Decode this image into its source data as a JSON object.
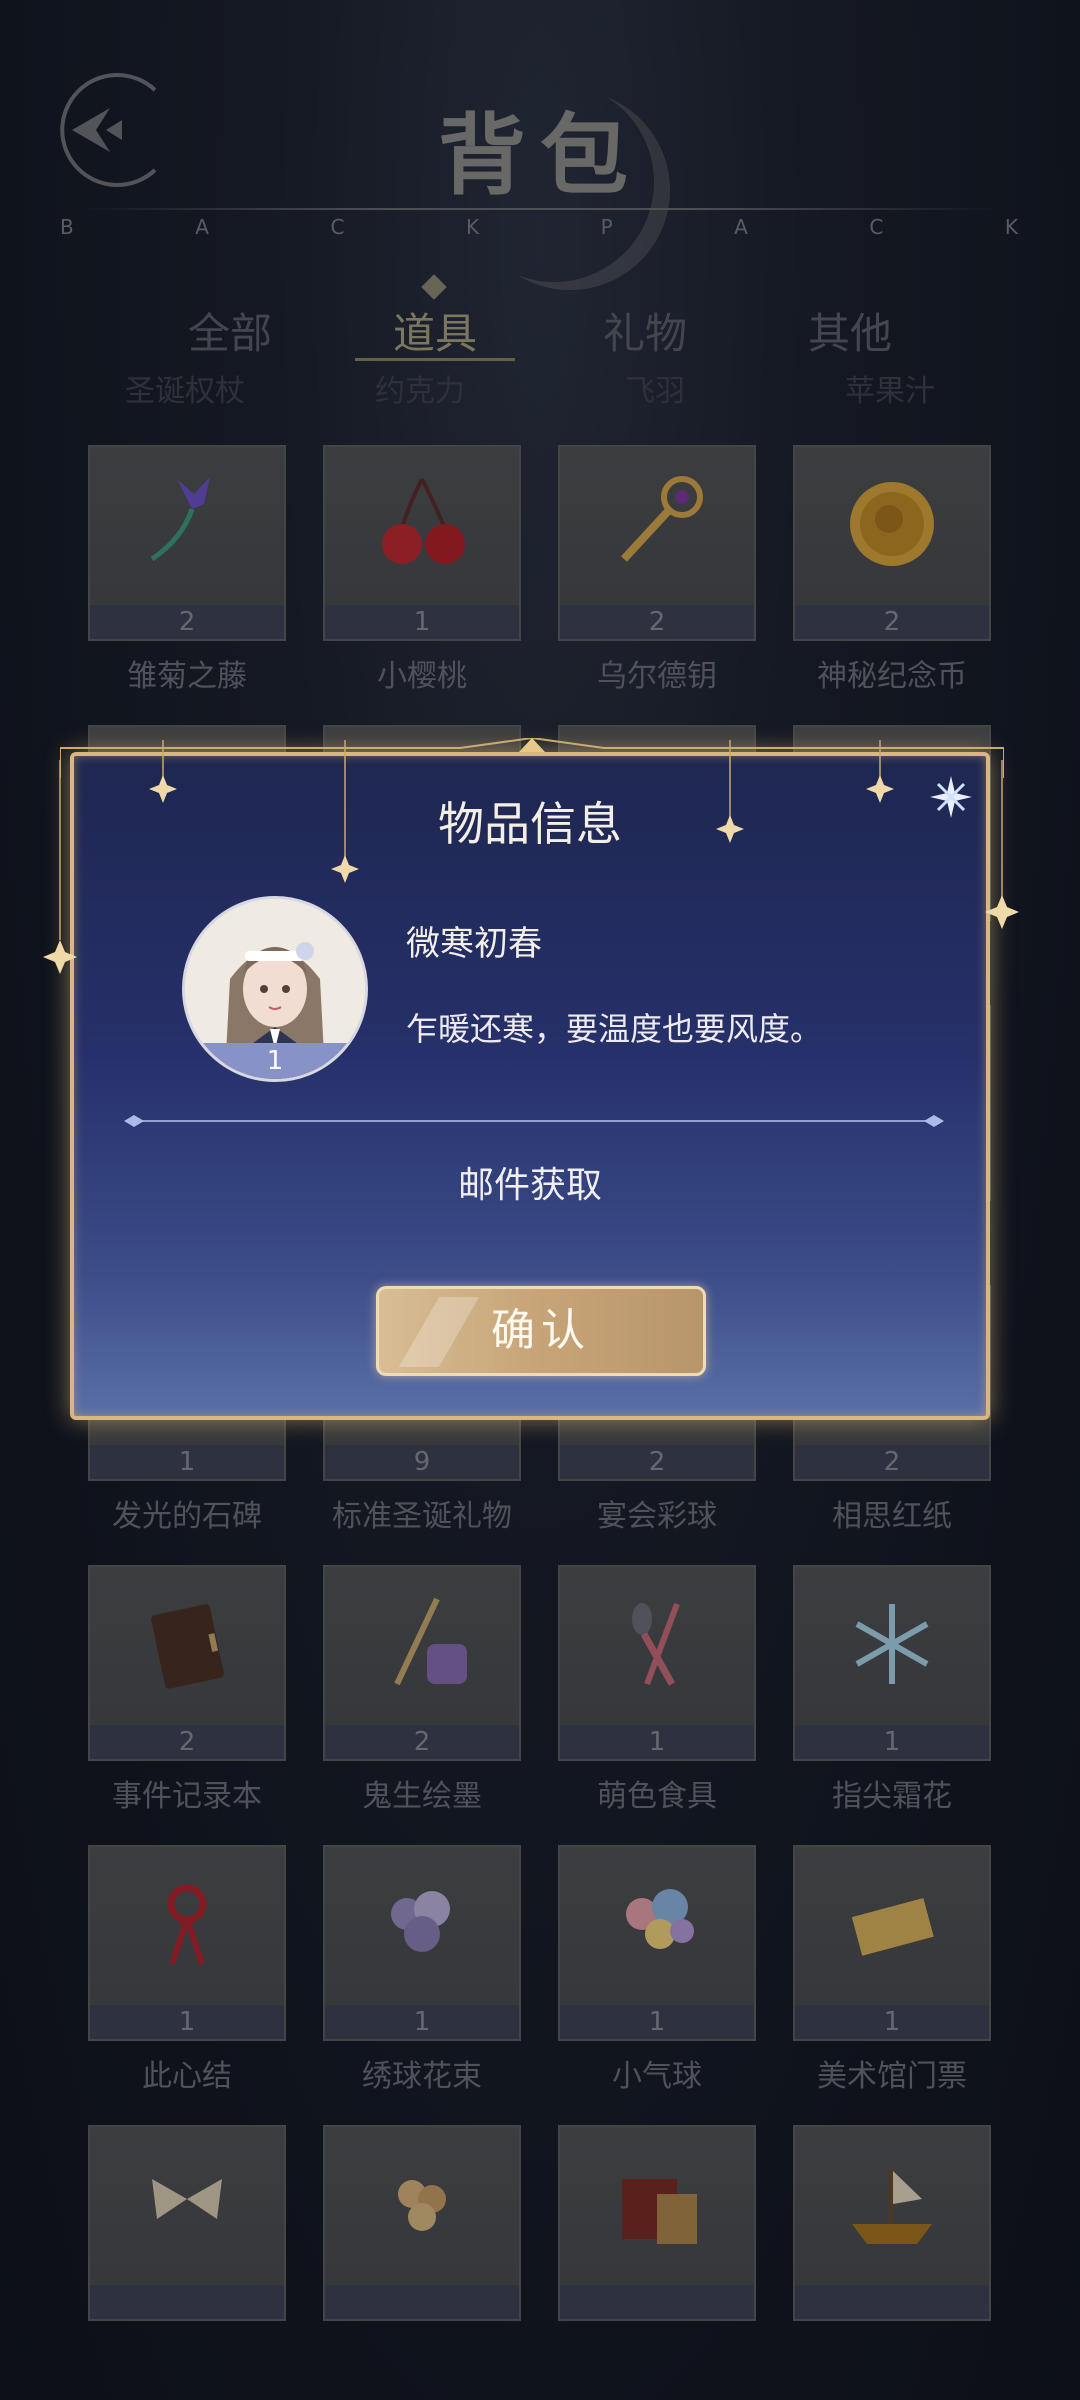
{
  "header": {
    "title": "背包",
    "subtitle_letters": [
      "B",
      "A",
      "C",
      "K",
      "P",
      "A",
      "C",
      "K"
    ]
  },
  "tabs": [
    {
      "label": "全部",
      "active": false
    },
    {
      "label": "道具",
      "active": true
    },
    {
      "label": "礼物",
      "active": false
    },
    {
      "label": "其他",
      "active": false
    }
  ],
  "ghost_row": [
    "圣诞权杖",
    "约克力",
    "飞羽",
    "苹果汁"
  ],
  "items": [
    {
      "name": "雏菊之藤",
      "count": "2",
      "icon": "flower-vine-icon"
    },
    {
      "name": "小樱桃",
      "count": "1",
      "icon": "cherry-icon"
    },
    {
      "name": "乌尔德钥",
      "count": "2",
      "icon": "key-icon"
    },
    {
      "name": "神秘纪念币",
      "count": "2",
      "icon": "coin-icon"
    },
    {
      "name": "",
      "count": "",
      "icon": "hidden-item-icon"
    },
    {
      "name": "",
      "count": "",
      "icon": "hidden-item-icon"
    },
    {
      "name": "",
      "count": "",
      "icon": "hidden-item-icon"
    },
    {
      "name": "",
      "count": "",
      "icon": "hidden-item-icon"
    },
    {
      "name": "",
      "count": "",
      "icon": "hidden-item-icon"
    },
    {
      "name": "",
      "count": "",
      "icon": "hidden-item-icon"
    },
    {
      "name": "",
      "count": "",
      "icon": "hidden-item-icon"
    },
    {
      "name": "",
      "count": "",
      "icon": "hidden-item-icon"
    },
    {
      "name": "发光的石碑",
      "count": "1",
      "icon": "stone-tablet-icon"
    },
    {
      "name": "标准圣诞礼物",
      "count": "9",
      "icon": "gift-icon"
    },
    {
      "name": "宴会彩球",
      "count": "2",
      "icon": "party-ball-icon"
    },
    {
      "name": "相思红纸",
      "count": "2",
      "icon": "red-paper-icon"
    },
    {
      "name": "事件记录本",
      "count": "2",
      "icon": "notebook-icon"
    },
    {
      "name": "鬼生绘墨",
      "count": "2",
      "icon": "ink-pen-icon"
    },
    {
      "name": "萌色食具",
      "count": "1",
      "icon": "cutlery-icon"
    },
    {
      "name": "指尖霜花",
      "count": "1",
      "icon": "snowflake-icon"
    },
    {
      "name": "此心结",
      "count": "1",
      "icon": "knot-icon"
    },
    {
      "name": "绣球花束",
      "count": "1",
      "icon": "bouquet-icon"
    },
    {
      "name": "小气球",
      "count": "1",
      "icon": "balloon-icon"
    },
    {
      "name": "美术馆门票",
      "count": "1",
      "icon": "ticket-icon"
    },
    {
      "name": "",
      "count": "",
      "icon": "bow-icon"
    },
    {
      "name": "",
      "count": "",
      "icon": "rose-bouquet-icon"
    },
    {
      "name": "",
      "count": "",
      "icon": "book-box-icon"
    },
    {
      "name": "",
      "count": "",
      "icon": "ship-icon"
    }
  ],
  "modal": {
    "title": "物品信息",
    "item_name": "微寒初春",
    "item_count": "1",
    "description": "乍暖还寒，要温度也要风度。",
    "source": "邮件获取",
    "confirm_label": "确认"
  },
  "colors": {
    "modal_border": "#d9b77e",
    "modal_bg": "#26306a",
    "confirm_button": "#c8a679"
  }
}
